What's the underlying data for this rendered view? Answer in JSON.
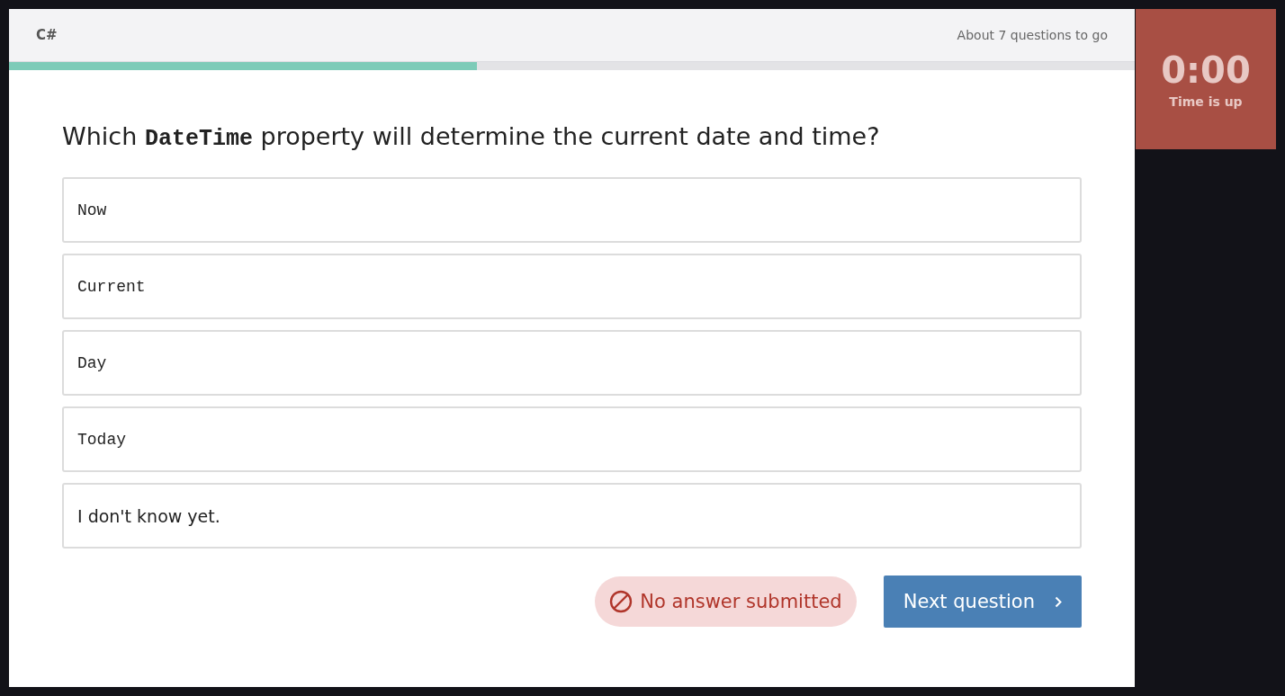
{
  "header": {
    "topic": "C#",
    "remaining": "About 7 questions to go"
  },
  "progress": {
    "level": 0.416
  },
  "timer": {
    "time": "0:00",
    "label": "Time is up",
    "expired": true
  },
  "question": {
    "before": "Which",
    "code": "DateTime",
    "after": "property will determine the current date and time?"
  },
  "options": [
    {
      "kind": "code",
      "label": "Now",
      "selected": false
    },
    {
      "kind": "code",
      "label": "Current",
      "selected": false
    },
    {
      "kind": "code",
      "label": "Day",
      "selected": false
    },
    {
      "kind": "code",
      "label": "Today",
      "selected": false
    },
    {
      "kind": "text",
      "label": "I don't know yet.",
      "selected": false
    }
  ],
  "status": {
    "text": "No answer submitted"
  },
  "next_button": {
    "label": "Next question"
  }
}
